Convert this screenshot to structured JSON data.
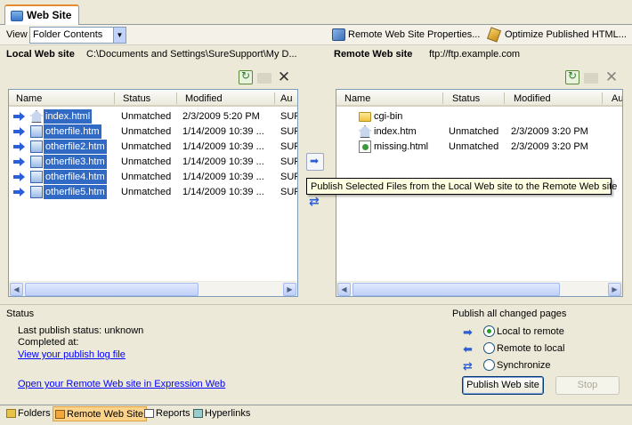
{
  "tab": {
    "title": "Web Site"
  },
  "viewbar": {
    "view_label": "View",
    "view_value": "Folder Contents",
    "remote_props_label": "Remote Web Site Properties...",
    "optimize_label": "Optimize Published HTML..."
  },
  "local": {
    "title": "Local Web site",
    "path": "C:\\Documents and Settings\\SureSupport\\My D...",
    "columns": [
      "Name",
      "Status",
      "Modified",
      "Au"
    ],
    "rows": [
      {
        "name": "index.html",
        "status": "Unmatched",
        "modified": "2/3/2009 5:20 PM",
        "author": "SUF"
      },
      {
        "name": "otherfile.htm",
        "status": "Unmatched",
        "modified": "1/14/2009 10:39 ...",
        "author": "SUF"
      },
      {
        "name": "otherfile2.htm",
        "status": "Unmatched",
        "modified": "1/14/2009 10:39 ...",
        "author": "SUF"
      },
      {
        "name": "otherfile3.htm",
        "status": "Unmatched",
        "modified": "1/14/2009 10:39 ...",
        "author": "SUF"
      },
      {
        "name": "otherfile4.htm",
        "status": "Unmatched",
        "modified": "1/14/2009 10:39 ...",
        "author": "SUF"
      },
      {
        "name": "otherfile5.htm",
        "status": "Unmatched",
        "modified": "1/14/2009 10:39 ...",
        "author": "SUF"
      }
    ]
  },
  "remote": {
    "title": "Remote Web site",
    "path": "ftp://ftp.example.com",
    "columns": [
      "Name",
      "Status",
      "Modified",
      "Au"
    ],
    "rows": [
      {
        "name": "cgi-bin",
        "status": "",
        "modified": ""
      },
      {
        "name": "index.htm",
        "status": "Unmatched",
        "modified": "2/3/2009 3:20 PM"
      },
      {
        "name": "missing.html",
        "status": "Unmatched",
        "modified": "2/3/2009 3:20 PM"
      }
    ]
  },
  "tooltip": "Publish Selected Files from the Local Web site to the Remote Web site",
  "status": {
    "heading": "Status",
    "last_publish": "Last publish status: unknown",
    "completed": "Completed at:",
    "log_link": "View your publish log file",
    "open_link": "Open your Remote Web site in Expression Web"
  },
  "publish": {
    "heading": "Publish all changed pages",
    "options": [
      "Local to remote",
      "Remote to local",
      "Synchronize"
    ],
    "selected": "Local to remote",
    "publish_button": "Publish Web site",
    "stop_button": "Stop"
  },
  "bottom_tabs": [
    "Folders",
    "Remote Web Site",
    "Reports",
    "Hyperlinks"
  ],
  "active_bottom_tab": "Remote Web Site"
}
